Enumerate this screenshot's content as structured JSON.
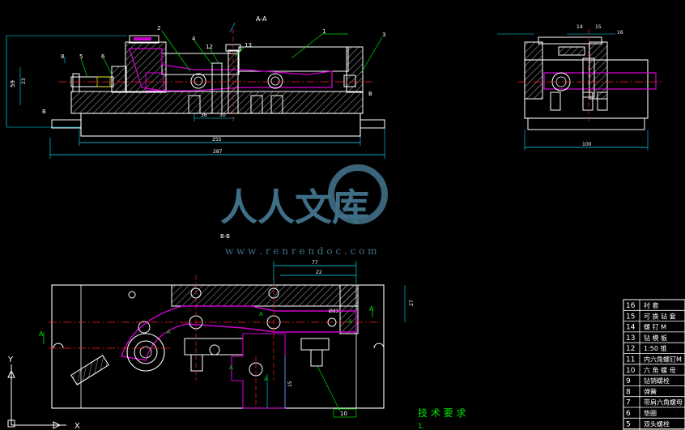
{
  "views": {
    "section_aa": "A-A",
    "section_bb": "B-B"
  },
  "dims": {
    "left_height": "59",
    "side_small": "23",
    "len_255": "255",
    "len_287": "287",
    "d_36": "36",
    "d_30": "30",
    "side_width": "100",
    "plan_77": "77",
    "plan_22": "22",
    "plan_27": "27",
    "plan_15": "15"
  },
  "callouts": {
    "top": [
      "2",
      "4",
      "12",
      "13",
      "1",
      "3"
    ],
    "side": [
      "14",
      "15",
      "16"
    ],
    "plan": [
      "10"
    ],
    "left": [
      "5",
      "6",
      "8"
    ]
  },
  "section_marks": [
    "A",
    "A",
    "B",
    "B",
    "A",
    "A",
    "A",
    "A",
    "A"
  ],
  "hole_note": "Ød3",
  "tech": {
    "title": "技 术 要 求",
    "line1": "1."
  },
  "parts_table": {
    "rows": [
      {
        "no": "16",
        "name": "衬 套"
      },
      {
        "no": "15",
        "name": "可 换 钻 套"
      },
      {
        "no": "14",
        "name": "螺 钉 M"
      },
      {
        "no": "13",
        "name": "钻 模 板"
      },
      {
        "no": "12",
        "name": "1:50 锥"
      },
      {
        "no": "11",
        "name": "内六角螺钉M"
      },
      {
        "no": "10",
        "name": "六 角 螺 母"
      },
      {
        "no": "9",
        "name": "钻销螺栓"
      },
      {
        "no": "8",
        "name": "弹簧"
      },
      {
        "no": "7",
        "name": "带肩六角螺母"
      },
      {
        "no": "6",
        "name": "垫圈"
      },
      {
        "no": "5",
        "name": "双头螺栓"
      }
    ]
  },
  "ucs": {
    "x": "X",
    "y": "Y"
  },
  "watermark": {
    "cn": "人人文库",
    "url": "w w w . r e n r e n d o c . c o m"
  },
  "colors": {
    "background": "#000000",
    "outline": "#ffffff",
    "part": "#d000d0",
    "dimension": "#00e5ff",
    "leader": "#00e000",
    "centerline": "#ff2020",
    "hatch": "#ffffff",
    "accent": "#e8e800"
  }
}
